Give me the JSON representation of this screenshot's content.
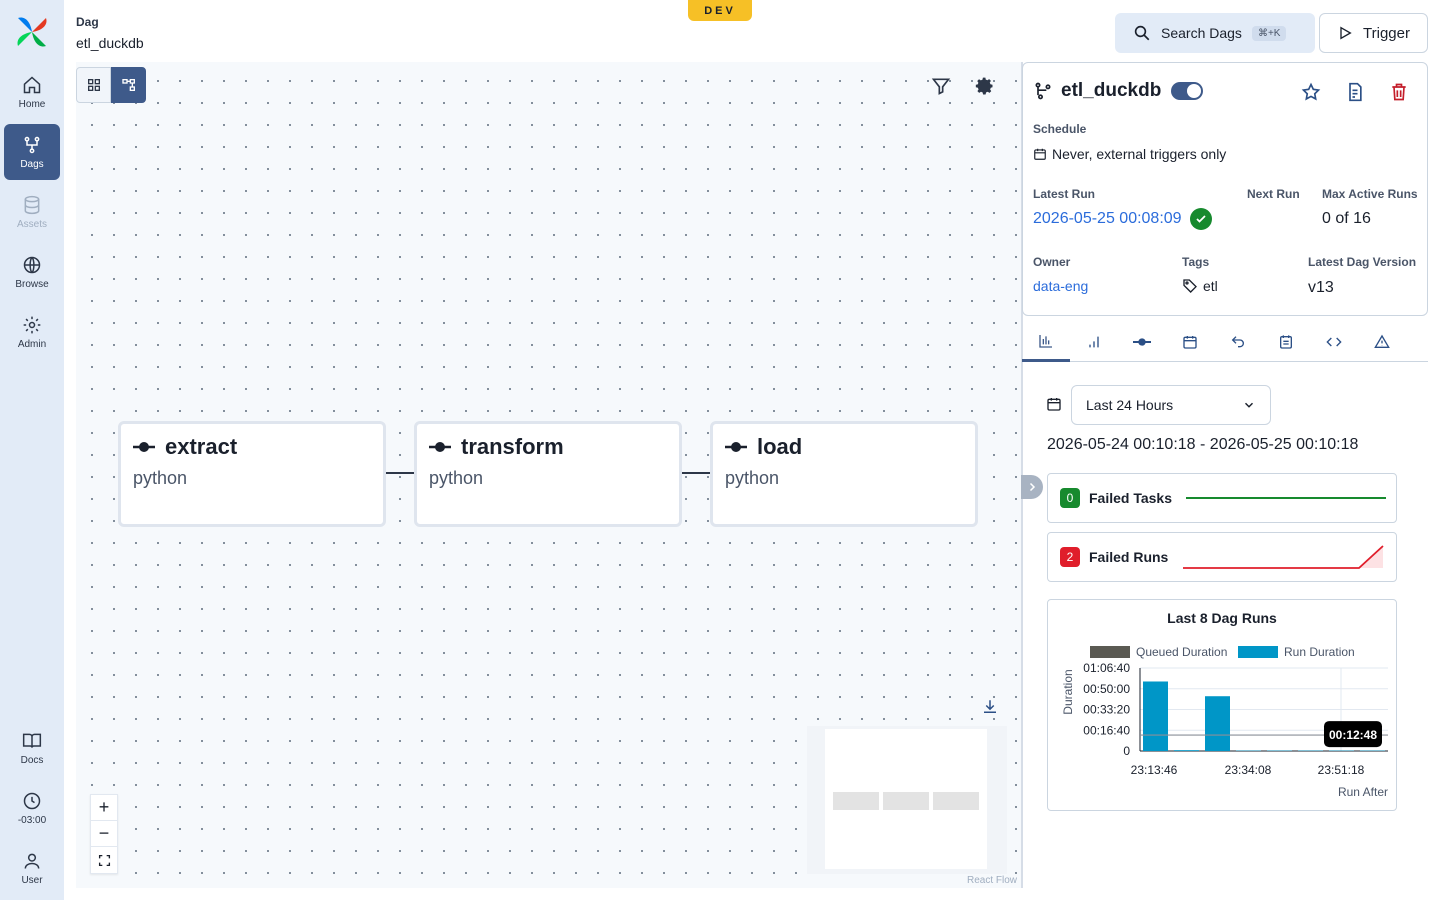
{
  "env_badge": "DEV",
  "breadcrumb": {
    "label": "Dag",
    "value": "etl_duckdb"
  },
  "nav": {
    "items": [
      {
        "label": "Home",
        "icon": "home-icon"
      },
      {
        "label": "Dags",
        "icon": "dags-icon"
      },
      {
        "label": "Assets",
        "icon": "database-icon"
      },
      {
        "label": "Browse",
        "icon": "globe-icon"
      },
      {
        "label": "Admin",
        "icon": "gear-icon"
      }
    ],
    "bottom": [
      {
        "label": "Docs",
        "icon": "book-icon"
      },
      {
        "label": "-03:00",
        "icon": "clock-icon"
      },
      {
        "label": "User",
        "icon": "user-icon"
      }
    ]
  },
  "header_actions": {
    "search_label": "Search Dags",
    "search_shortcut": "⌘+K",
    "trigger_label": "Trigger"
  },
  "graph": {
    "tasks": [
      {
        "name": "extract",
        "type": "python"
      },
      {
        "name": "transform",
        "type": "python"
      },
      {
        "name": "load",
        "type": "python"
      }
    ],
    "attribution": "React Flow"
  },
  "dag_details": {
    "dag_id": "etl_duckdb",
    "schedule_label": "Schedule",
    "schedule_value": "Never, external triggers only",
    "latest_run_label": "Latest Run",
    "latest_run_value": "2026-05-25 00:08:09",
    "next_run_label": "Next Run",
    "max_active_runs_label": "Max Active Runs",
    "max_active_runs_value": "0 of 16",
    "owner_label": "Owner",
    "owner_value": "data-eng",
    "tags_label": "Tags",
    "tags_value": "etl",
    "version_label": "Latest Dag Version",
    "version_value": "v13"
  },
  "overview": {
    "range_option": "Last 24 Hours",
    "range_text": "2026-05-24 00:10:18 - 2026-05-25 00:10:18",
    "failed_tasks": {
      "count": "0",
      "label": "Failed Tasks",
      "color": "#178a2e"
    },
    "failed_runs": {
      "count": "2",
      "label": "Failed Runs",
      "color": "#e01e2b"
    }
  },
  "chart_data": {
    "type": "bar",
    "title": "Last 8 Dag Runs",
    "xlabel": "Run After",
    "ylabel": "Duration",
    "legend": [
      "Queued Duration",
      "Run Duration"
    ],
    "legend_placement": "top",
    "y_ticks": [
      "0",
      "00:16:40",
      "00:33:20",
      "00:50:00",
      "01:06:40"
    ],
    "x_ticks": [
      "23:13:46",
      "23:34:08",
      "23:51:18"
    ],
    "ylim_seconds": [
      0,
      4000
    ],
    "series": [
      {
        "name": "Queued Duration",
        "color": "#5b5a53",
        "values": [
          0,
          0,
          0,
          0,
          0,
          0,
          0,
          0
        ]
      },
      {
        "name": "Run Duration",
        "color": "#0096c7",
        "values": [
          3350,
          40,
          2640,
          20,
          20,
          20,
          20,
          20
        ]
      }
    ],
    "reference_line_seconds": 768,
    "reference_label": "00:12:48",
    "grid": true
  }
}
